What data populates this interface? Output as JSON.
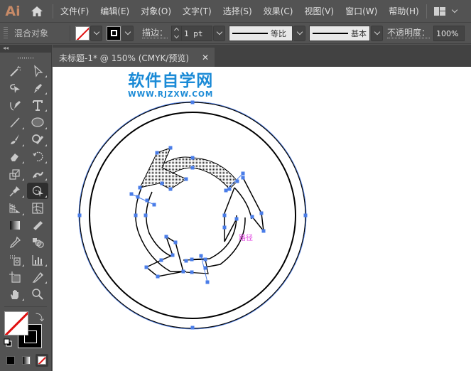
{
  "app": {
    "logo": "Ai",
    "home_icon": "home-icon",
    "menu": [
      "文件(F)",
      "编辑(E)",
      "对象(O)",
      "文字(T)",
      "选择(S)",
      "效果(C)",
      "视图(V)",
      "窗口(W)",
      "帮助(H)"
    ],
    "workspace_icon": "workspace-layout-icon"
  },
  "control_bar": {
    "selection_label": "混合对象",
    "fill_icon": "fill-none-swatch",
    "stroke_icon": "stroke-swatch",
    "stroke_label": "描边：",
    "stroke_weight": "1 pt",
    "variable_width_label": "等比",
    "brush_label": "基本",
    "opacity_label": "不透明度：",
    "opacity_value": "100%"
  },
  "document_tab": {
    "title": "未标题-1* @ 150% (CMYK/预览)",
    "close_icon": "close-icon"
  },
  "tools": [
    {
      "name": "magic-wand-tool",
      "flyout": false
    },
    {
      "name": "direct-selection-tool",
      "flyout": true
    },
    {
      "name": "lasso-tool",
      "flyout": false
    },
    {
      "name": "pen-tool",
      "flyout": true
    },
    {
      "name": "curvature-tool",
      "flyout": false
    },
    {
      "name": "type-tool",
      "flyout": true
    },
    {
      "name": "line-segment-tool",
      "flyout": true
    },
    {
      "name": "ellipse-tool",
      "flyout": true
    },
    {
      "name": "paintbrush-tool",
      "flyout": true
    },
    {
      "name": "shaper-tool",
      "flyout": true
    },
    {
      "name": "eraser-tool",
      "flyout": true
    },
    {
      "name": "rotate-tool",
      "flyout": true
    },
    {
      "name": "scale-tool",
      "flyout": true
    },
    {
      "name": "puppet-warp-tool",
      "flyout": true
    },
    {
      "name": "pin-tool",
      "flyout": true
    },
    {
      "name": "shape-builder-tool",
      "flyout": true,
      "active": true
    },
    {
      "name": "perspective-grid-tool",
      "flyout": true
    },
    {
      "name": "mesh-tool",
      "flyout": false
    },
    {
      "name": "gradient-tool",
      "flyout": false
    },
    {
      "name": "measure-tool",
      "flyout": false
    },
    {
      "name": "eyedropper-tool",
      "flyout": false
    },
    {
      "name": "blend-tool",
      "flyout": false
    },
    {
      "name": "symbol-sprayer-tool",
      "flyout": true
    },
    {
      "name": "column-graph-tool",
      "flyout": true
    },
    {
      "name": "artboard-tool",
      "flyout": false
    },
    {
      "name": "slice-tool",
      "flyout": true
    },
    {
      "name": "hand-tool",
      "flyout": true
    },
    {
      "name": "zoom-tool",
      "flyout": false
    }
  ],
  "color_panel": {
    "fill": "none",
    "stroke": "#000000",
    "modes": [
      "color",
      "gradient",
      "none"
    ]
  },
  "canvas": {
    "watermark_title": "软件自学网",
    "watermark_url": "WWW.RJZXW.COM",
    "hover_label": "路径",
    "colors": {
      "selection": "#4a7de8",
      "stroke": "#000000",
      "watermark": "#1a8ad6",
      "smart_guide": "#e040e0"
    }
  }
}
